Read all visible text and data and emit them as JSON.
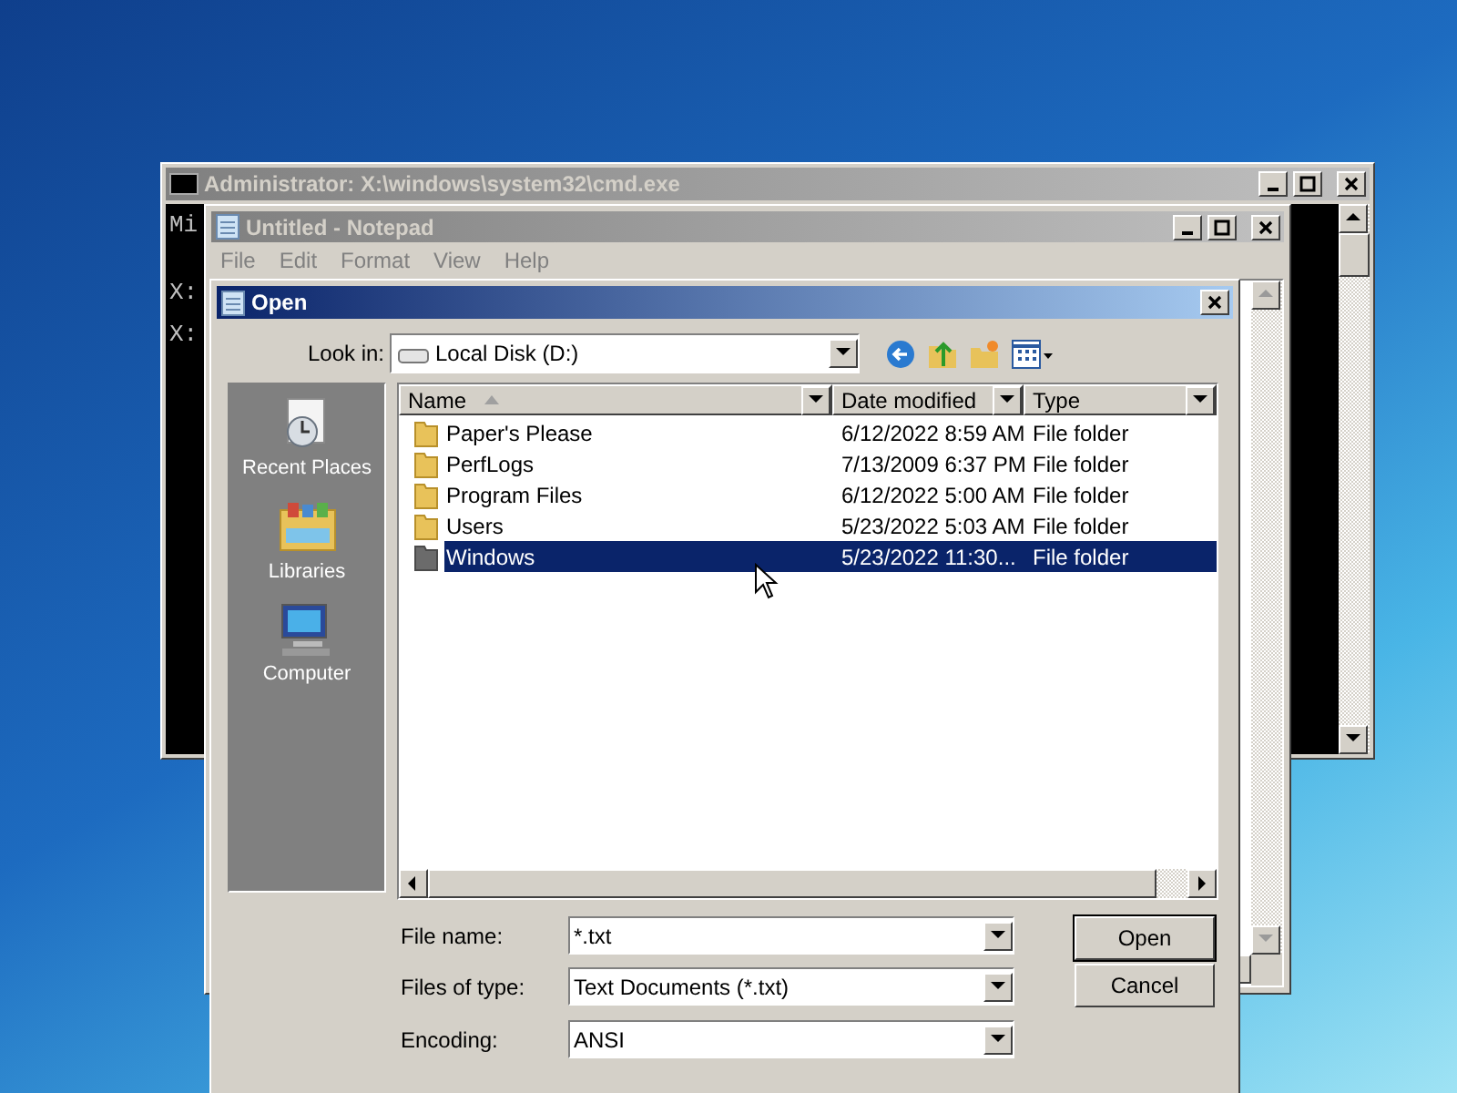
{
  "console_window": {
    "title": "Administrator: X:\\windows\\system32\\cmd.exe",
    "lines": [
      "Mi",
      "X:",
      "X:"
    ]
  },
  "notepad_window": {
    "title": "Untitled - Notepad",
    "menu": [
      "File",
      "Edit",
      "Format",
      "View",
      "Help"
    ]
  },
  "open_dialog": {
    "title": "Open",
    "look_in": {
      "label": "Look in:",
      "value": "Local Disk (D:)"
    },
    "places": [
      {
        "kind": "recent",
        "label": "Recent Places"
      },
      {
        "kind": "libraries",
        "label": "Libraries"
      },
      {
        "kind": "computer",
        "label": "Computer"
      }
    ],
    "columns": [
      "Name",
      "Date modified",
      "Type"
    ],
    "files": [
      {
        "name": "Paper's Please",
        "date": "6/12/2022 8:59 AM",
        "type": "File folder",
        "selected": false
      },
      {
        "name": "PerfLogs",
        "date": "7/13/2009 6:37 PM",
        "type": "File folder",
        "selected": false
      },
      {
        "name": "Program Files",
        "date": "6/12/2022 5:00 AM",
        "type": "File folder",
        "selected": false
      },
      {
        "name": "Users",
        "date": "5/23/2022 5:03 AM",
        "type": "File folder",
        "selected": false
      },
      {
        "name": "Windows",
        "date": "5/23/2022 11:30...",
        "type": "File folder",
        "selected": true
      }
    ],
    "fields": [
      {
        "label": "File name:",
        "value": "*.txt"
      },
      {
        "label": "Files of type:",
        "value": "Text Documents (*.txt)"
      },
      {
        "label": "Encoding:",
        "value": "ANSI"
      }
    ],
    "buttons": [
      "Open",
      "Cancel"
    ]
  }
}
